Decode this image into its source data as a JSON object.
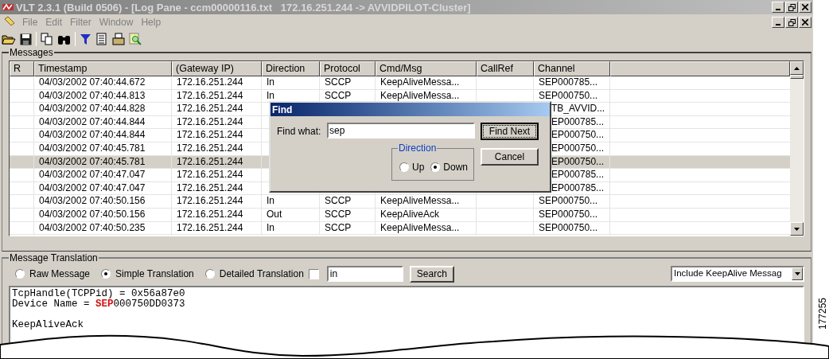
{
  "window": {
    "title": "VLT 2.3.1 (Build 0506) - [Log Pane - ccm00000116.txt   172.16.251.244 -> AVVIDPILOT-Cluster]"
  },
  "menu": [
    "File",
    "Edit",
    "Filter",
    "Window",
    "Help"
  ],
  "messages": {
    "title": "Messages",
    "columns": [
      "R",
      "Timestamp",
      "(Gateway IP)",
      "Direction",
      "Protocol",
      "Cmd/Msg",
      "CallRef",
      "Channel"
    ],
    "rows": [
      {
        "timestamp": "04/03/2002 07:40:44.672",
        "gateway_ip": "172.16.251.244",
        "direction": "In",
        "protocol": "SCCP",
        "cmd_msg": "KeepAliveMessa...",
        "channel": "SEP000785...",
        "selected": false
      },
      {
        "timestamp": "04/03/2002 07:40:44.813",
        "gateway_ip": "172.16.251.244",
        "direction": "In",
        "protocol": "SCCP",
        "cmd_msg": "KeepAliveMessa...",
        "channel": "SEP000750...",
        "selected": false
      },
      {
        "timestamp": "04/03/2002 07:40:44.828",
        "gateway_ip": "172.16.251.244",
        "channel": "TB_AVVID...",
        "selected": false
      },
      {
        "timestamp": "04/03/2002 07:40:44.844",
        "gateway_ip": "172.16.251.244",
        "channel": "EP000785...",
        "selected": false
      },
      {
        "timestamp": "04/03/2002 07:40:44.844",
        "gateway_ip": "172.16.251.244",
        "channel": "EP000750...",
        "selected": false
      },
      {
        "timestamp": "04/03/2002 07:40:45.781",
        "gateway_ip": "172.16.251.244",
        "channel": "EP000750...",
        "selected": false
      },
      {
        "timestamp": "04/03/2002 07:40:45.781",
        "gateway_ip": "172.16.251.244",
        "channel": "EP000750...",
        "selected": true
      },
      {
        "timestamp": "04/03/2002 07:40:47.047",
        "gateway_ip": "172.16.251.244",
        "channel": "EP000785...",
        "selected": false
      },
      {
        "timestamp": "04/03/2002 07:40:47.047",
        "gateway_ip": "172.16.251.244",
        "channel": "EP000785...",
        "selected": false
      },
      {
        "timestamp": "04/03/2002 07:40:50.156",
        "gateway_ip": "172.16.251.244",
        "direction": "In",
        "protocol": "SCCP",
        "cmd_msg": "KeepAliveMessa...",
        "channel": "SEP000750...",
        "selected": false
      },
      {
        "timestamp": "04/03/2002 07:40:50.156",
        "gateway_ip": "172.16.251.244",
        "direction": "Out",
        "protocol": "SCCP",
        "cmd_msg": "KeepAliveAck",
        "channel": "SEP000750...",
        "selected": false
      },
      {
        "timestamp": "04/03/2002 07:40:50.235",
        "gateway_ip": "172.16.251.244",
        "direction": "In",
        "protocol": "SCCP",
        "cmd_msg": "KeepAliveMessa...",
        "channel": "SEP000750...",
        "selected": false
      }
    ]
  },
  "find_dialog": {
    "title": "Find",
    "label": "Find what:",
    "value": "sep",
    "find_next": "Find Next",
    "cancel": "Cancel",
    "direction_group": "Direction",
    "directions": [
      {
        "label": "Up",
        "selected": false
      },
      {
        "label": "Down",
        "selected": true
      }
    ]
  },
  "translation": {
    "title": "Message Translation",
    "modes": [
      {
        "label": "Raw Message",
        "selected": false
      },
      {
        "label": "Simple Translation",
        "selected": true
      },
      {
        "label": "Detailed Translation",
        "selected": false
      }
    ],
    "checkbox": {
      "checked": false
    },
    "search_field": {
      "value": "in"
    },
    "search_button": "Search",
    "dropdown": {
      "value": "Include KeepAlive Messag"
    },
    "output_blocks": [
      {
        "lines": [
          "TcpHandle(TCPPid) = 0x56a87e0",
          "Device Name = **SEP**000750DD0373"
        ]
      },
      {
        "lines": [
          "KeepAliveAck"
        ]
      }
    ]
  },
  "figure_number": "177255"
}
